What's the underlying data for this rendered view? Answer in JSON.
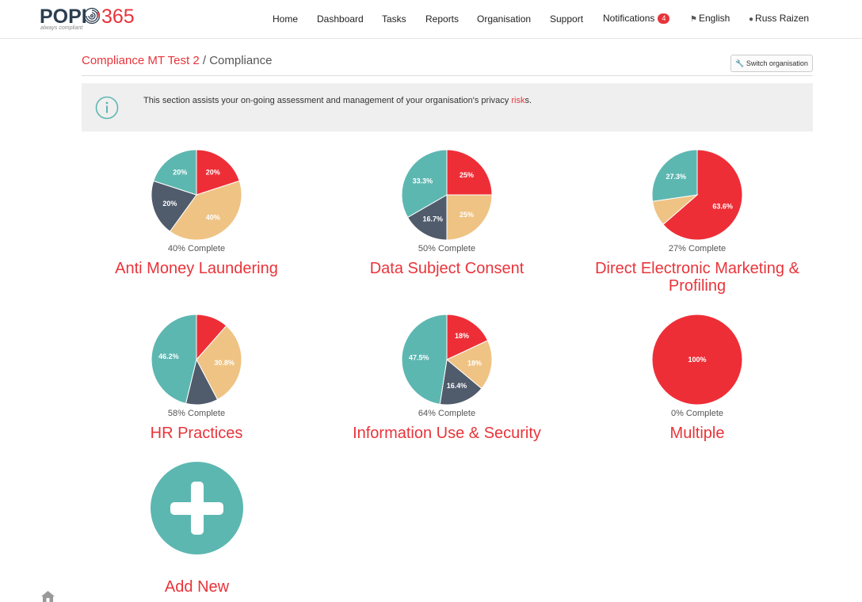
{
  "brand": {
    "logo_word": "POPI",
    "logo_number": "365",
    "tagline": "always compliant",
    "icon": "fingerprint-icon",
    "accent": "#e8343a",
    "teal": "#5db7b1"
  },
  "nav": {
    "home": "Home",
    "dashboard": "Dashboard",
    "tasks": "Tasks",
    "reports": "Reports",
    "organisation": "Organisation",
    "support": "Support",
    "notifications": "Notifications",
    "notifications_count": "4",
    "language": "English",
    "language_icon": "language-icon",
    "user": "Russ Raizen",
    "user_icon": "user-icon"
  },
  "breadcrumb": {
    "org": "Compliance MT Test 2",
    "separator": " / ",
    "current": "Compliance",
    "switch_label": "Switch organisation",
    "switch_icon": "wrench-icon"
  },
  "info": {
    "icon": "info-icon",
    "text_before": "This section assists your on-going assessment and management of your organisation's privacy ",
    "link": "risk",
    "text_after": "s."
  },
  "palette": {
    "red": "#ee2e37",
    "tan": "#efc384",
    "slate": "#505b6b",
    "teal": "#5db7b1"
  },
  "chart_data": [
    {
      "type": "pie",
      "title": "Anti Money Laundering",
      "subtitle": "40% Complete",
      "slices": [
        {
          "color": "red",
          "value": 20,
          "label": "20%"
        },
        {
          "color": "tan",
          "value": 40,
          "label": "40%"
        },
        {
          "color": "slate",
          "value": 20,
          "label": "20%"
        },
        {
          "color": "teal",
          "value": 20,
          "label": "20%"
        }
      ]
    },
    {
      "type": "pie",
      "title": "Data Subject Consent",
      "subtitle": "50% Complete",
      "slices": [
        {
          "color": "red",
          "value": 25,
          "label": "25%"
        },
        {
          "color": "tan",
          "value": 25,
          "label": "25%"
        },
        {
          "color": "slate",
          "value": 16.7,
          "label": "16.7%"
        },
        {
          "color": "teal",
          "value": 33.3,
          "label": "33.3%"
        }
      ]
    },
    {
      "type": "pie",
      "title": "Direct Electronic Marketing & Profiling",
      "subtitle": "27% Complete",
      "slices": [
        {
          "color": "red",
          "value": 63.6,
          "label": "63.6%"
        },
        {
          "color": "tan",
          "value": 9.1,
          "label": ""
        },
        {
          "color": "teal",
          "value": 27.3,
          "label": "27.3%"
        }
      ]
    },
    {
      "type": "pie",
      "title": "HR Practices",
      "subtitle": "58% Complete",
      "slices": [
        {
          "color": "red",
          "value": 11.5,
          "label": ""
        },
        {
          "color": "tan",
          "value": 30.8,
          "label": "30.8%"
        },
        {
          "color": "slate",
          "value": 11.5,
          "label": ""
        },
        {
          "color": "teal",
          "value": 46.2,
          "label": "46.2%"
        }
      ]
    },
    {
      "type": "pie",
      "title": "Information Use & Security",
      "subtitle": "64% Complete",
      "slices": [
        {
          "color": "red",
          "value": 18,
          "label": "18%"
        },
        {
          "color": "tan",
          "value": 18,
          "label": "18%"
        },
        {
          "color": "slate",
          "value": 16.4,
          "label": "16.4%"
        },
        {
          "color": "teal",
          "value": 47.5,
          "label": "47.5%"
        }
      ]
    },
    {
      "type": "pie",
      "title": "Multiple",
      "subtitle": "0% Complete",
      "slices": [
        {
          "color": "red",
          "value": 100,
          "label": "100%"
        }
      ]
    }
  ],
  "add_new": {
    "label": "Add New",
    "icon": "plus-icon"
  },
  "footer": {
    "home_icon": "home-icon"
  }
}
